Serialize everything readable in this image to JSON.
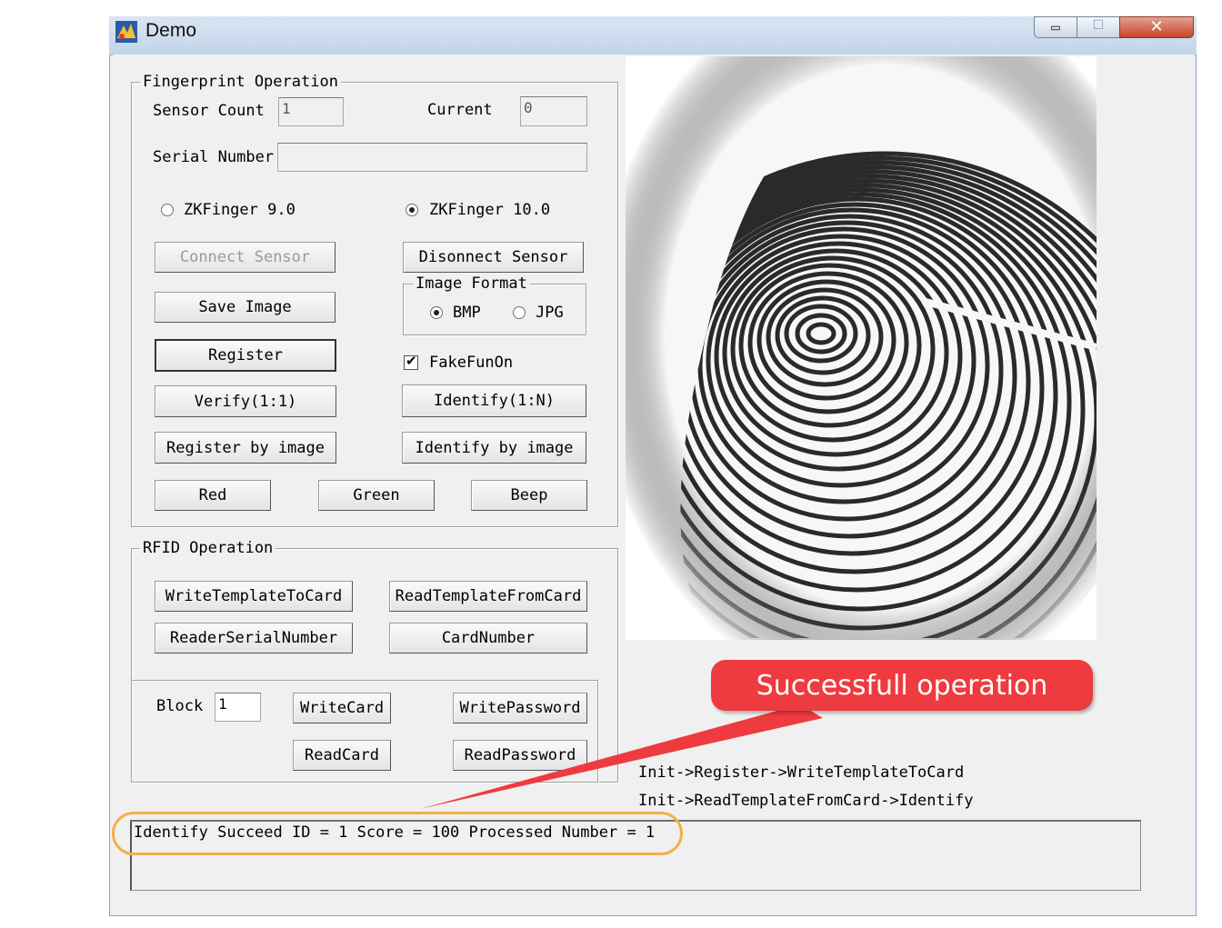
{
  "window": {
    "title": "Demo"
  },
  "fingerprint": {
    "group_title": "Fingerprint Operation",
    "sensor_count_label": "Sensor Count",
    "sensor_count_value": "1",
    "current_label": "Current",
    "current_value": "0",
    "serial_label": "Serial Number",
    "serial_value": "",
    "version_options": [
      "ZKFinger 9.0",
      "ZKFinger 10.0"
    ],
    "selected_version": "ZKFinger 10.0",
    "buttons": {
      "connect": "Connect Sensor",
      "disconnect": "Disonnect Sensor",
      "save_image": "Save Image",
      "register": "Register",
      "verify": "Verify(1:1)",
      "identify": "Identify(1:N)",
      "register_by_image": "Register by image",
      "identify_by_image": "Identify by image",
      "red": "Red",
      "green": "Green",
      "beep": "Beep"
    },
    "image_format": {
      "title": "Image Format",
      "options": [
        "BMP",
        "JPG"
      ],
      "selected": "BMP"
    },
    "fake_fun_on": {
      "label": "FakeFunOn",
      "checked": true
    }
  },
  "rfid": {
    "group_title": "RFID Operation",
    "buttons": {
      "write_template": "WriteTemplateToCard",
      "read_template": "ReadTemplateFromCard",
      "reader_serial": "ReaderSerialNumber",
      "card_number": "CardNumber",
      "write_card": "WriteCard",
      "write_password": "WritePassword",
      "read_card": "ReadCard",
      "read_password": "ReadPassword"
    },
    "block_label": "Block",
    "block_value": "1"
  },
  "notes": [
    "Init->Register->WriteTemplateToCard",
    "Init->ReadTemplateFromCard->Identify"
  ],
  "log": {
    "text": "Identify Succeed ID = 1 Score = 100  Processed Number = 1"
  },
  "annotation": {
    "callout": "Successfull operation"
  },
  "colors": {
    "callout": "#ee3b3f",
    "highlight": "#f0b14a",
    "window_bg": "#f0f0f0"
  }
}
